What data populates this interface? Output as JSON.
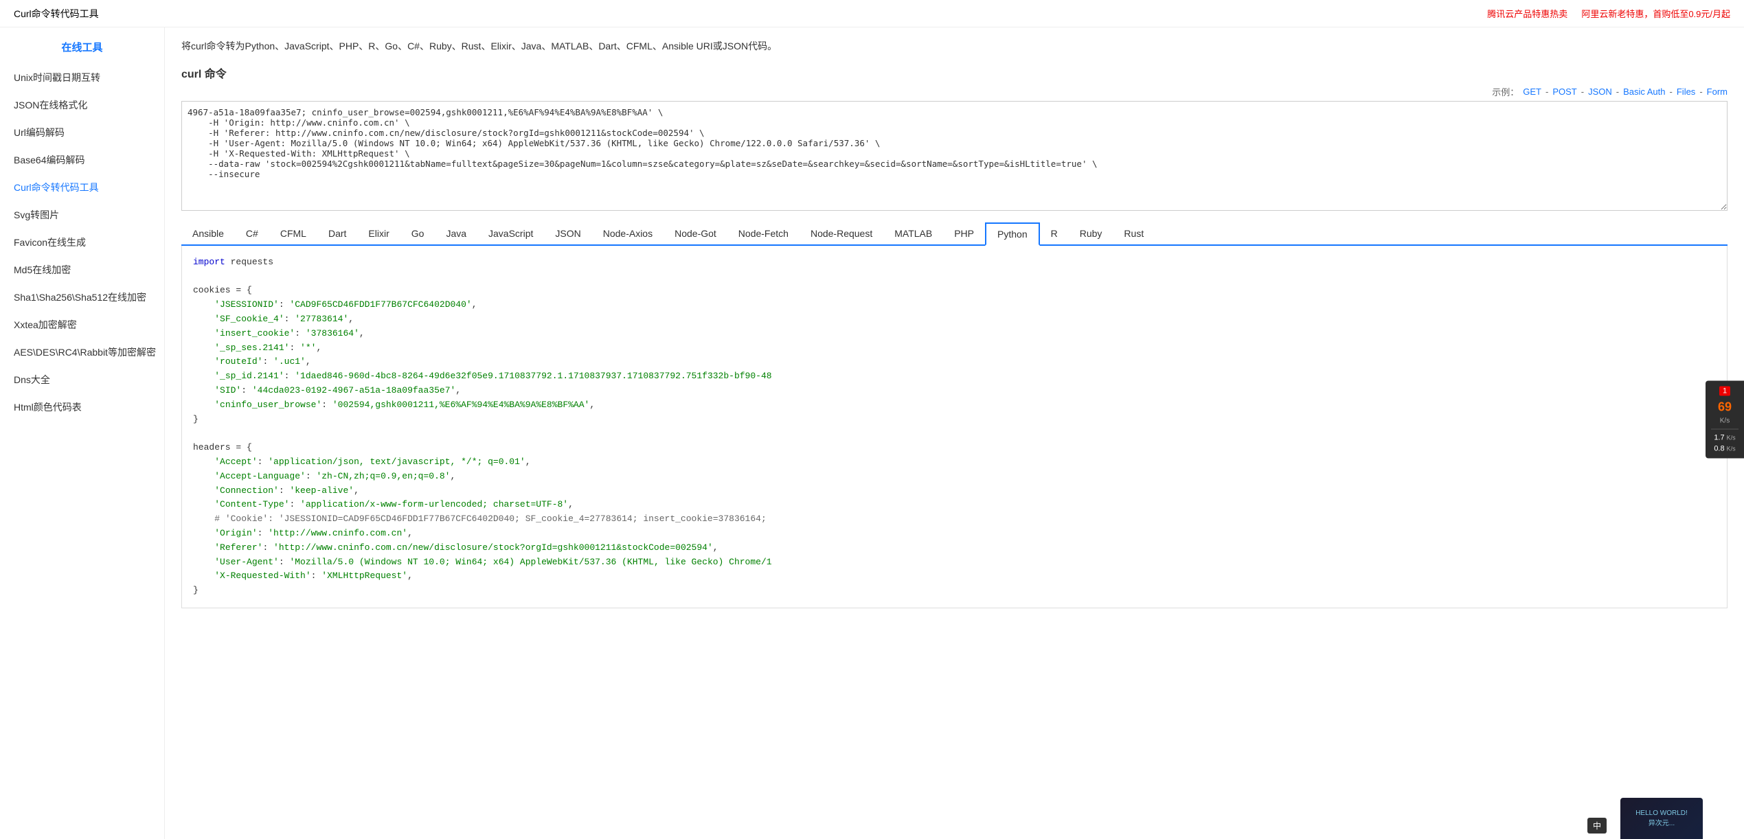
{
  "header": {
    "title": "Curl命令转代码工具",
    "site_title": "在线工具",
    "ad_tencent": "腾讯云产品特惠热卖",
    "ad_ali": "阿里云新老特惠，首购低至0.9元/月起"
  },
  "sidebar": {
    "items": [
      {
        "label": "Unix时间戳日期互转",
        "active": false
      },
      {
        "label": "JSON在线格式化",
        "active": false
      },
      {
        "label": "Url编码解码",
        "active": false
      },
      {
        "label": "Base64编码解码",
        "active": false
      },
      {
        "label": "Curl命令转代码工具",
        "active": true
      },
      {
        "label": "Svg转图片",
        "active": false
      },
      {
        "label": "Favicon在线生成",
        "active": false
      },
      {
        "label": "Md5在线加密",
        "active": false
      },
      {
        "label": "Sha1\\Sha256\\Sha512在线加密",
        "active": false
      },
      {
        "label": "Xxtea加密解密",
        "active": false
      },
      {
        "label": "AES\\DES\\RC4\\Rabbit等加密解密",
        "active": false
      },
      {
        "label": "Dns大全",
        "active": false
      },
      {
        "label": "Html颜色代码表",
        "active": false
      }
    ]
  },
  "page": {
    "desc": "将curl命令转为Python、JavaScript、PHP、R、Go、C#、Ruby、Rust、Elixir、Java、MATLAB、Dart、CFML、Ansible URI或JSON代码。",
    "curl_label": "curl 命令",
    "example_label": "示例：",
    "example_links": [
      "GET",
      "POST",
      "JSON",
      "Basic Auth",
      "Files",
      "Form"
    ],
    "curl_value": "4967-a51a-18a09faa35e7; cninfo_user_browse=002594,gshk0001211,%E6%AF%94%E4%BA%9A%E8%BF%AA' \\\n    -H 'Origin: http://www.cninfo.com.cn' \\\n    -H 'Referer: http://www.cninfo.com.cn/new/disclosure/stock?orgId=gshk0001211&stockCode=002594' \\\n    -H 'User-Agent: Mozilla/5.0 (Windows NT 10.0; Win64; x64) AppleWebKit/537.36 (KHTML, like Gecko) Chrome/122.0.0.0 Safari/537.36' \\\n    -H 'X-Requested-With: XMLHttpRequest' \\\n    --data-raw 'stock=002594%2Cgshk0001211&tabName=fulltext&pageSize=30&pageNum=1&column=szse&category=&plate=sz&seDate=&searchkey=&secid=&sortName=&sortType=&isHLtitle=true' \\\n    --insecure"
  },
  "tabs": {
    "items": [
      "Ansible",
      "C#",
      "CFML",
      "Dart",
      "Elixir",
      "Go",
      "Java",
      "JavaScript",
      "JSON",
      "Node-Axios",
      "Node-Got",
      "Node-Fetch",
      "Node-Request",
      "MATLAB",
      "PHP",
      "Python",
      "R",
      "Ruby",
      "Rust"
    ],
    "active": "Python"
  },
  "code_output": {
    "lines": [
      {
        "type": "code",
        "content": "import requests"
      },
      {
        "type": "blank"
      },
      {
        "type": "code",
        "content": "cookies = {"
      },
      {
        "type": "code",
        "content": "    'JSESSIONID': 'CAD9F65CD46FDD1F77B67CFC6402D040',"
      },
      {
        "type": "code",
        "content": "    'SF_cookie_4': '27783614',"
      },
      {
        "type": "code",
        "content": "    'insert_cookie': '37836164',"
      },
      {
        "type": "code",
        "content": "    '_sp_ses.2141': '*',"
      },
      {
        "type": "code",
        "content": "    'routeId': '.uc1',"
      },
      {
        "type": "code",
        "content": "    '_sp_id.2141': '1daed846-960d-4bc8-8264-49d6e32f05e9.1710837792.1.1710837937.1710837792.751f332b-bf90-48"
      },
      {
        "type": "code",
        "content": "    'SID': '44cda023-0192-4967-a51a-18a09faa35e7',"
      },
      {
        "type": "code",
        "content": "    'cninfo_user_browse': '002594,gshk0001211,%E6%AF%94%E4%BA%9A%E8%BF%AA',"
      },
      {
        "type": "code",
        "content": "}"
      },
      {
        "type": "blank"
      },
      {
        "type": "code",
        "content": "headers = {"
      },
      {
        "type": "code",
        "content": "    'Accept': 'application/json, text/javascript, */*; q=0.01',"
      },
      {
        "type": "code",
        "content": "    'Accept-Language': 'zh-CN,zh;q=0.9,en;q=0.8',"
      },
      {
        "type": "code",
        "content": "    'Connection': 'keep-alive',"
      },
      {
        "type": "code",
        "content": "    'Content-Type': 'application/x-www-form-urlencoded; charset=UTF-8',"
      },
      {
        "type": "code",
        "content": "    # 'Cookie': 'JSESSIONID=CAD9F65CD46FDD1F77B67CFC6402D040; SF_cookie_4=27783614; insert_cookie=37836164; "
      },
      {
        "type": "code",
        "content": "    'Origin': 'http://www.cninfo.com.cn',"
      },
      {
        "type": "code",
        "content": "    'Referer': 'http://www.cninfo.com.cn/new/disclosure/stock?orgId=gshk0001211&stockCode=002594',"
      },
      {
        "type": "code",
        "content": "    'User-Agent': 'Mozilla/5.0 (Windows NT 10.0; Win64; x64) AppleWebKit/537.36 (KHTML, like Gecko) Chrome/1"
      },
      {
        "type": "code",
        "content": "    'X-Requested-With': 'XMLHttpRequest',"
      },
      {
        "type": "code",
        "content": "}"
      }
    ]
  },
  "widget": {
    "badge": "1",
    "number": "69",
    "unit": "K/s",
    "speed1": "1.7",
    "speed1_unit": "K/s",
    "speed2": "0.8",
    "speed2_unit": "K/s"
  },
  "ime": {
    "label": "中"
  }
}
